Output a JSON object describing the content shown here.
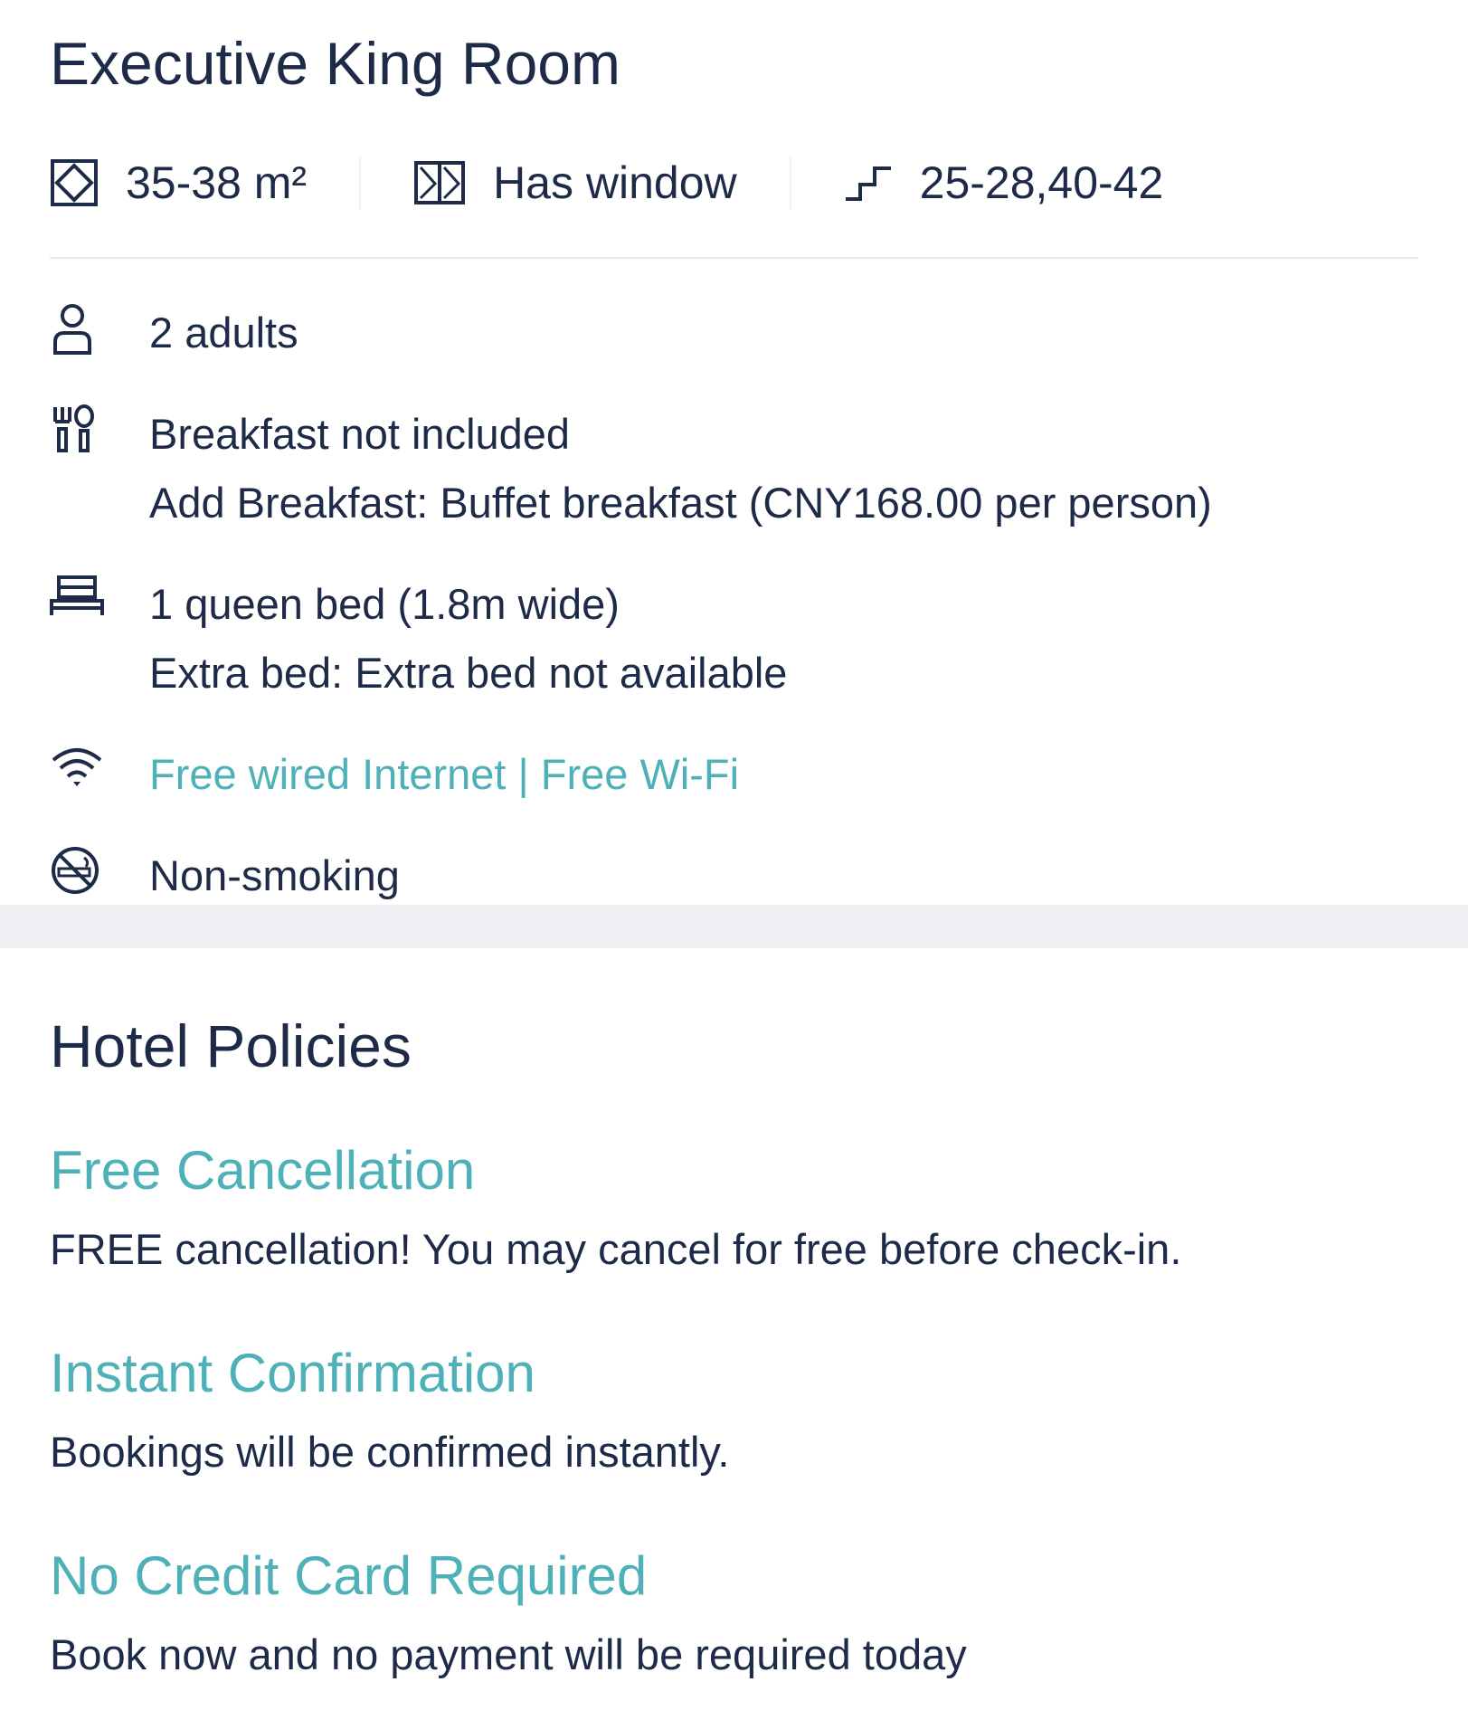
{
  "room": {
    "title": "Executive King Room",
    "specs": {
      "area": "35-38 m²",
      "window": "Has window",
      "floors": "25-28,40-42"
    },
    "facilities": {
      "occupancy": "2 adults",
      "breakfast": "Breakfast not included",
      "breakfast_addon": "Add Breakfast: Buffet breakfast (CNY168.00 per person)",
      "bed": "1 queen bed (1.8m wide)",
      "extra_bed": "Extra bed: Extra bed not available",
      "internet": "Free wired Internet | Free Wi-Fi",
      "smoking": "Non-smoking"
    },
    "icons": [
      "area-icon",
      "window-icon",
      "floor-stairs-icon",
      "person-icon",
      "dining-icon",
      "bed-icon",
      "wifi-icon",
      "no-smoking-icon"
    ]
  },
  "policies": {
    "title": "Hotel Policies",
    "items": [
      {
        "heading": "Free Cancellation",
        "description": "FREE cancellation! You may cancel for free before check-in."
      },
      {
        "heading": "Instant Confirmation",
        "description": "Bookings will be confirmed instantly."
      },
      {
        "heading": "No Credit Card Required",
        "description": "Book now and no payment will be required today"
      }
    ]
  },
  "colors": {
    "text": "#1d2b48",
    "accent": "#4fb1b8",
    "divider": "#e7e9ed",
    "band": "#eef0f3"
  }
}
